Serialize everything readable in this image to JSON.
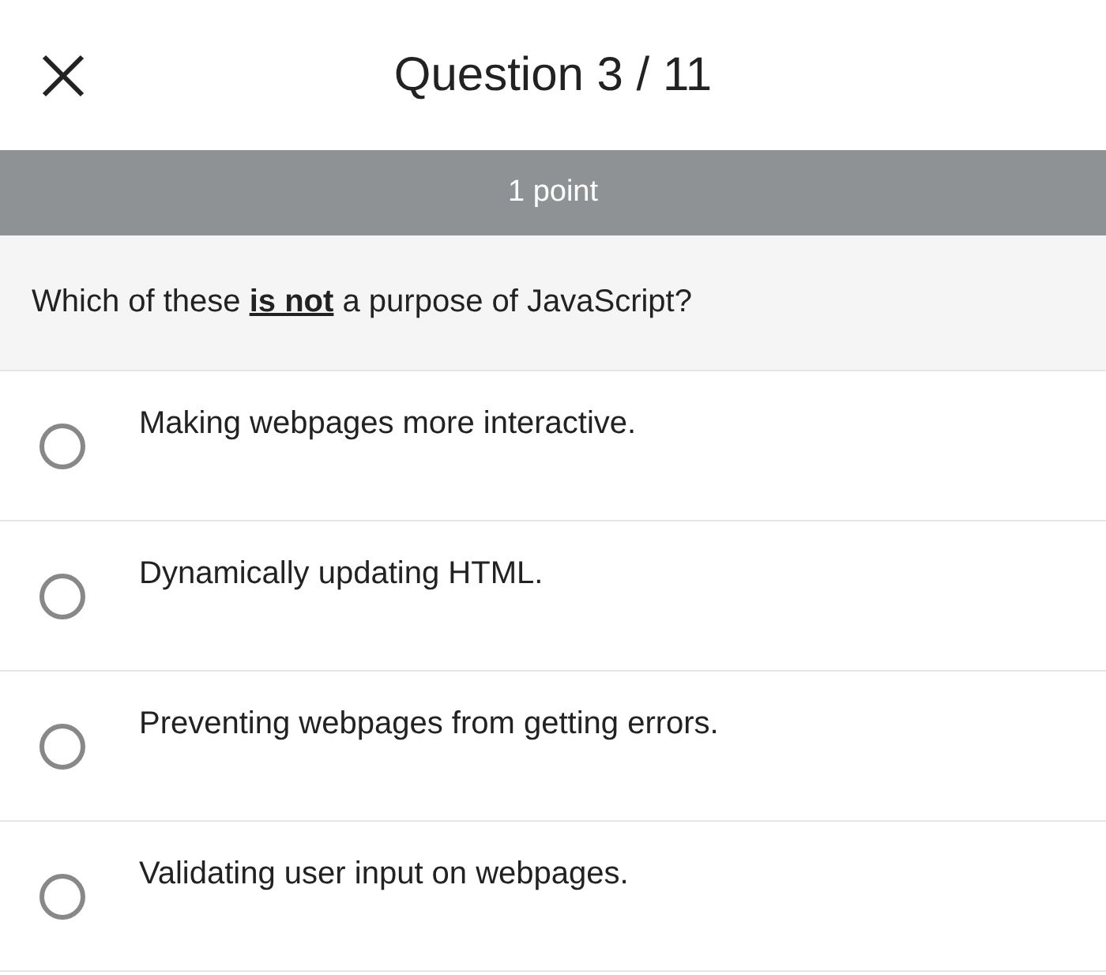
{
  "header": {
    "title": "Question 3 / 11"
  },
  "points_bar": {
    "text": "1 point"
  },
  "question": {
    "text": "Which of these **is not** a purpose of JavaScript?"
  },
  "options": [
    {
      "label": "Making webpages more interactive.",
      "selected": false
    },
    {
      "label": "Dynamically updating HTML.",
      "selected": false
    },
    {
      "label": "Preventing webpages from getting errors.",
      "selected": false
    },
    {
      "label": "Validating user input on webpages.",
      "selected": false
    }
  ]
}
